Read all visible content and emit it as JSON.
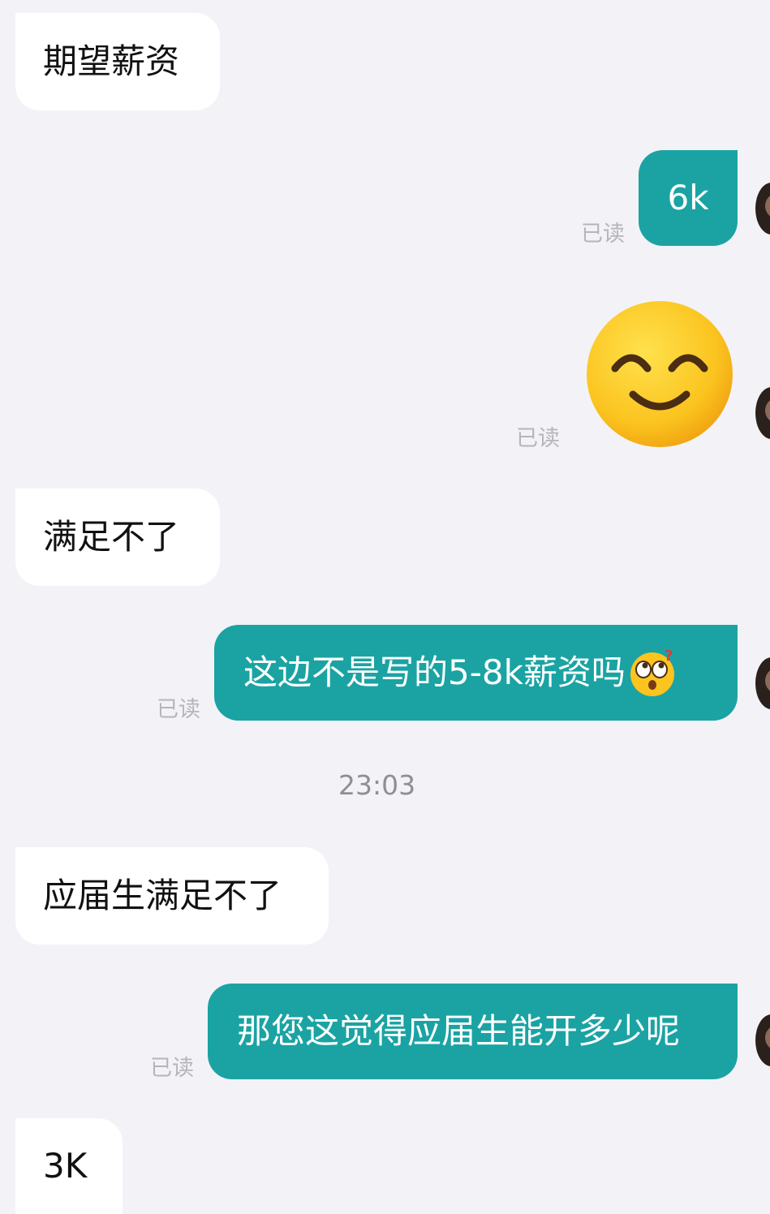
{
  "messages": [
    {
      "from": "them",
      "text": "期望薪资"
    },
    {
      "from": "me",
      "text": "6k",
      "status": "已读"
    },
    {
      "from": "me",
      "sticker": "smiling-face-sticker",
      "status": "已读"
    },
    {
      "from": "them",
      "text": "满足不了"
    },
    {
      "from": "me",
      "text": "这边不是写的5-8k薪资吗",
      "emoji": "eye-roll-face-emoji",
      "status": "已读"
    },
    {
      "from": "them",
      "text": "应届生满足不了"
    },
    {
      "from": "me",
      "text": "那您这觉得应届生能开多少呢",
      "status": "已读"
    },
    {
      "from": "them",
      "text": "3K"
    }
  ],
  "timestamp": "23:03",
  "colors": {
    "background": "#f3f3f7",
    "incoming": "#ffffff",
    "outgoing": "#1ba3a3",
    "read_receipt": "#b5b5ba"
  }
}
